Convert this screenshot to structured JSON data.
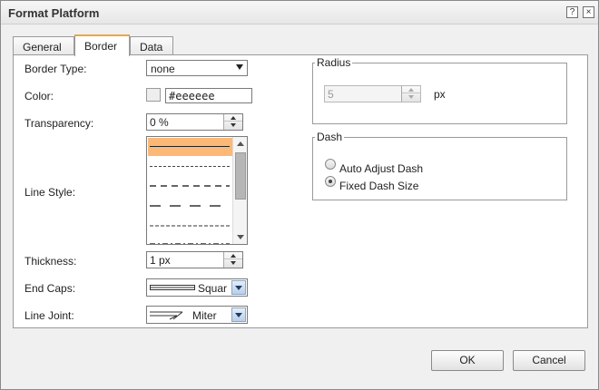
{
  "window": {
    "title": "Format Platform",
    "help_label": "?",
    "close_label": "×"
  },
  "tabs": [
    {
      "label": "General",
      "active": false
    },
    {
      "label": "Border",
      "active": true
    },
    {
      "label": "Data",
      "active": false
    }
  ],
  "border": {
    "border_type_label": "Border Type:",
    "border_type_value": "none",
    "color_label": "Color:",
    "color_value": "#eeeeee",
    "color_swatch": "#eeeeee",
    "transparency_label": "Transparency:",
    "transparency_value": "0 %",
    "line_style_label": "Line Style:",
    "line_styles": [
      "solid",
      "fine-dash",
      "dash",
      "long-dash",
      "fine-dash-2",
      "mixed-dash"
    ],
    "selected_line_style": 0,
    "thickness_label": "Thickness:",
    "thickness_value": "1 px",
    "end_caps_label": "End Caps:",
    "end_caps_value": "Squar",
    "line_joint_label": "Line Joint:",
    "line_joint_value": "Miter"
  },
  "radius": {
    "legend": "Radius",
    "value": "5",
    "unit": "px",
    "enabled": false
  },
  "dash": {
    "legend": "Dash",
    "options": [
      {
        "label": "Auto Adjust Dash",
        "checked": false
      },
      {
        "label": "Fixed Dash Size",
        "checked": true
      }
    ]
  },
  "footer": {
    "ok_label": "OK",
    "cancel_label": "Cancel"
  },
  "colors": {
    "selection": "#fbb877",
    "active_tab_accent": "#f0a540"
  }
}
